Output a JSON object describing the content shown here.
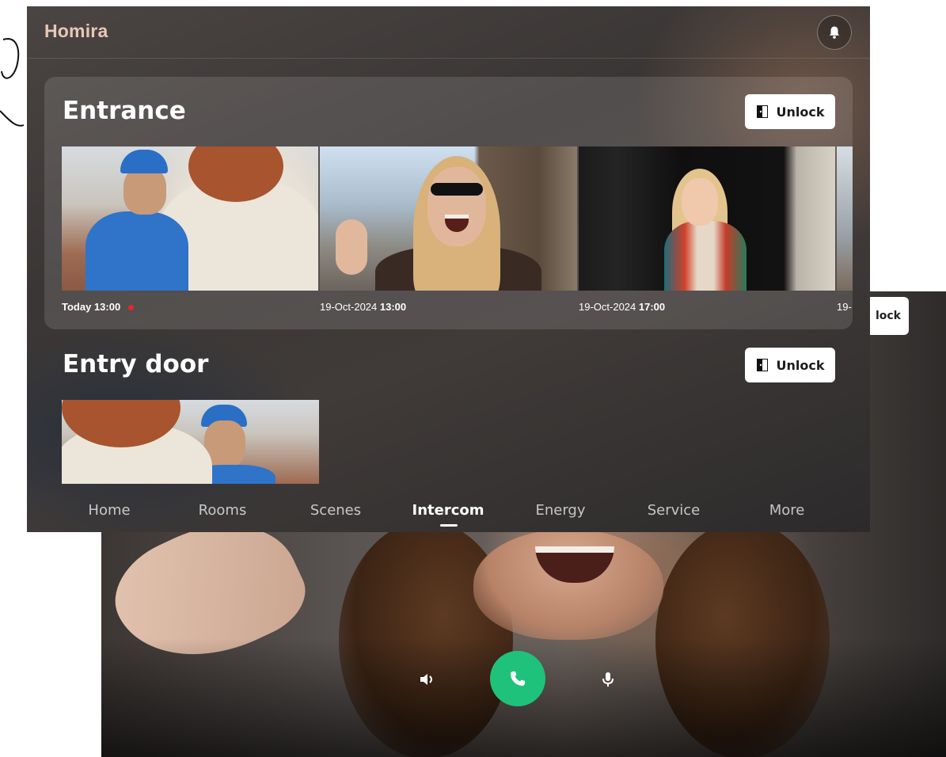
{
  "app": {
    "brand": "Homira"
  },
  "header": {
    "notifications_icon": "bell-icon"
  },
  "sections": [
    {
      "title": "Entrance",
      "unlock_label": "Unlock",
      "unlock_icon": "door-icon",
      "recordings": [
        {
          "date": "Today 13:00",
          "time": "",
          "missed": true
        },
        {
          "date": "19-Oct-2024",
          "time": "13:00"
        },
        {
          "date": "19-Oct-2024",
          "time": "17:00"
        },
        {
          "date": "19-",
          "time": ""
        }
      ]
    },
    {
      "title": "Entry door",
      "unlock_label": "Unlock",
      "unlock_icon": "door-icon"
    }
  ],
  "nav": {
    "items": [
      "Home",
      "Rooms",
      "Scenes",
      "Intercom",
      "Energy",
      "Service",
      "More"
    ],
    "active": "Intercom"
  },
  "call_screen": {
    "unlock_label_partial": "lock",
    "controls": {
      "speaker_icon": "speaker-icon",
      "answer_icon": "phone-icon",
      "mic_icon": "microphone-icon",
      "answer_color": "#1FC27A"
    }
  },
  "colors": {
    "accent_green": "#1FC27A",
    "missed_red": "#E8262B",
    "brand": "#E8C8B8"
  }
}
